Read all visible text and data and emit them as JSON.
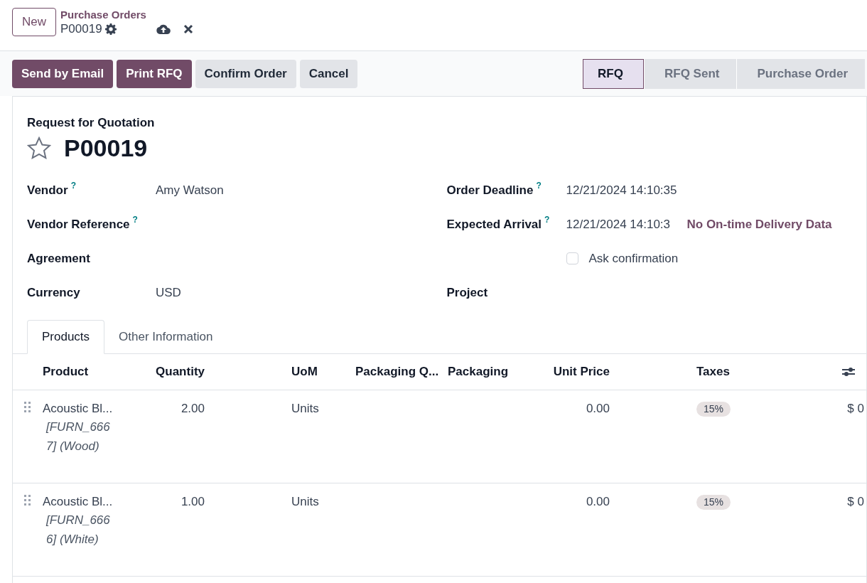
{
  "header": {
    "new_button": "New",
    "breadcrumb": "Purchase Orders",
    "record": "P00019"
  },
  "actions": [
    {
      "label": "Send by Email",
      "kind": "primary"
    },
    {
      "label": "Print RFQ",
      "kind": "primary"
    },
    {
      "label": "Confirm Order",
      "kind": "secondary"
    },
    {
      "label": "Cancel",
      "kind": "secondary"
    }
  ],
  "stages": [
    {
      "label": "RFQ",
      "selected": true
    },
    {
      "label": "RFQ Sent",
      "selected": false
    },
    {
      "label": "Purchase Order",
      "selected": false
    }
  ],
  "form": {
    "subtitle": "Request for Quotation",
    "title": "P00019",
    "starred": false,
    "left_fields": [
      {
        "label": "Vendor",
        "help": "?",
        "value": "Amy Watson"
      },
      {
        "label": "Vendor Reference",
        "help": "?"
      },
      {
        "label": "Agreement"
      },
      {
        "label": "Currency",
        "value": "USD"
      }
    ],
    "right_fields": [
      {
        "kind": "field",
        "label": "Order Deadline",
        "help": "?",
        "value": "12/21/2024 14:10:35"
      },
      {
        "kind": "field",
        "label": "Expected Arrival",
        "help": "?",
        "value": "12/21/2024 14:10:3",
        "link": "No On-time Delivery Data"
      },
      {
        "kind": "checkbox",
        "label": "Ask confirmation",
        "checked": false
      },
      {
        "kind": "field",
        "label": "Project"
      }
    ]
  },
  "tabs": [
    {
      "label": "Products",
      "selected": true
    },
    {
      "label": "Other Information",
      "selected": false
    }
  ],
  "table": {
    "columns": [
      "Product",
      "Quantity",
      "UoM",
      "Packaging Q...",
      "Packaging",
      "Unit Price",
      "Taxes"
    ],
    "rows": [
      {
        "product": "Acoustic Bl...",
        "description": "[FURN_6667] (Wood)",
        "quantity": "2.00",
        "uom": "Units",
        "unit_price": "0.00",
        "tax": "15%",
        "amount": "$ 0"
      },
      {
        "product": "Acoustic Bl...",
        "description": "[FURN_6666] (White)",
        "quantity": "1.00",
        "uom": "Units",
        "unit_price": "0.00",
        "tax": "15%",
        "amount": "$ 0"
      }
    ]
  }
}
